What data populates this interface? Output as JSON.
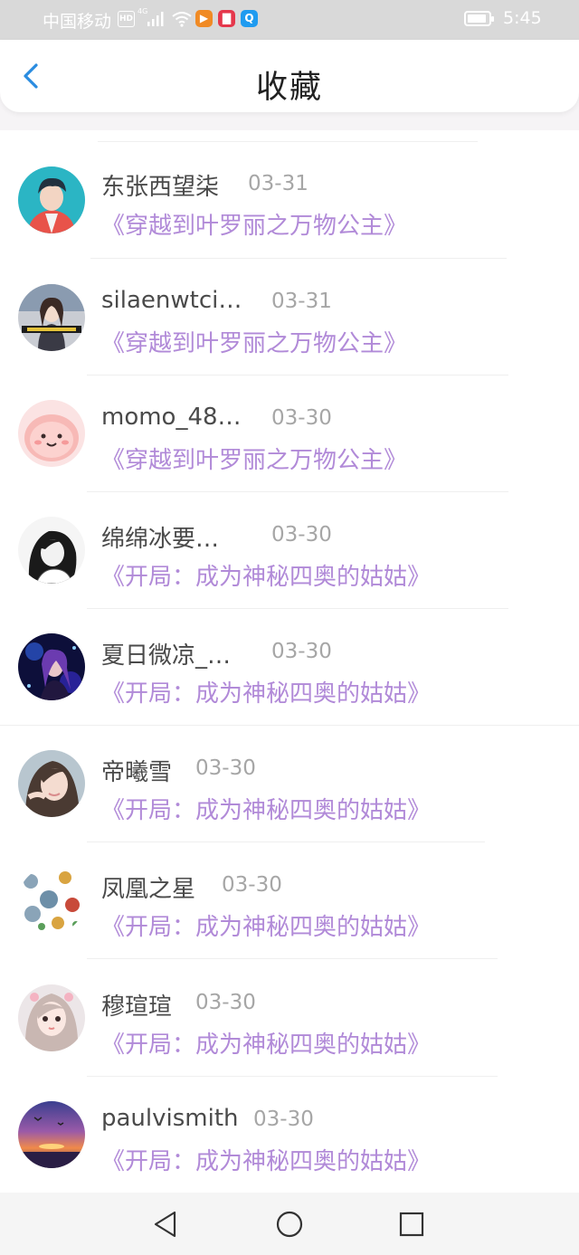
{
  "status_bar": {
    "carrier": "中国移动",
    "hd": "HD",
    "network": "4G",
    "app1": "▶",
    "app2": "▇",
    "app3": "Q",
    "time": "5:45"
  },
  "header": {
    "title": "收藏",
    "back_icon": "chevron-left"
  },
  "colors": {
    "accent": "#2a8ce0",
    "book_title": "#b18ad8",
    "name_text": "#4a4a4a",
    "date_text": "#a6a6a6"
  },
  "favorites": [
    {
      "name": "东张西望柒",
      "date": "03-31",
      "book": "《穿越到叶罗丽之万物公主》",
      "avatar": "anime-boy-teal"
    },
    {
      "name": "silaenwtci…",
      "date": "03-31",
      "book": "《穿越到叶罗丽之万物公主》",
      "avatar": "anime-girl-dark"
    },
    {
      "name": "momo_48…",
      "date": "03-30",
      "book": "《穿越到叶罗丽之万物公主》",
      "avatar": "pink-blob"
    },
    {
      "name": "绵绵冰要…",
      "date": "03-30",
      "book": "《开局：成为神秘四奥的姑姑》",
      "avatar": "sketch-girl"
    },
    {
      "name": "夏日微凉_…",
      "date": "03-30",
      "book": "《开局：成为神秘四奥的姑姑》",
      "avatar": "dark-purple-girl"
    },
    {
      "name": "帝曦雪",
      "date": "03-30",
      "book": "《开局：成为神秘四奥的姑姑》",
      "avatar": "photo-girl"
    },
    {
      "name": "凤凰之星",
      "date": "03-30",
      "book": "《开局：成为神秘四奥的姑姑》",
      "avatar": "cartoon-collage"
    },
    {
      "name": "穆瑄瑄",
      "date": "03-30",
      "book": "《开局：成为神秘四奥的姑姑》",
      "avatar": "doll-girl"
    },
    {
      "name": "paulvismith",
      "date": "03-30",
      "book": "《开局：成为神秘四奥的姑姑》",
      "avatar": "sunset"
    }
  ],
  "nav_bar": {
    "back_icon": "triangle-back",
    "home_icon": "circle-home",
    "recent_icon": "square-recents"
  }
}
